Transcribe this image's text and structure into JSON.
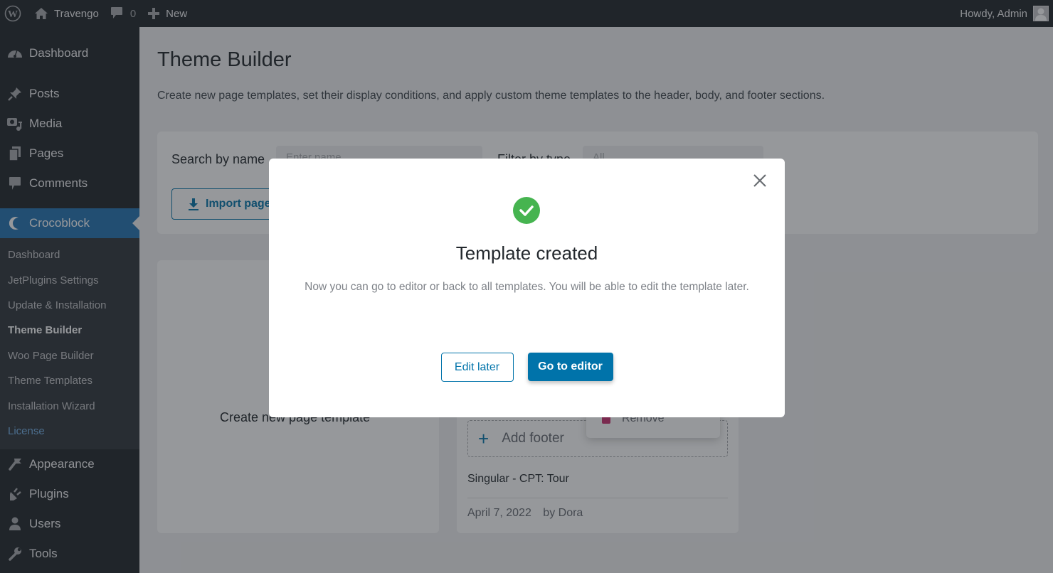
{
  "adminbar": {
    "site_name": "Travengo",
    "comments_count": "0",
    "new_label": "New",
    "greeting": "Howdy, Admin"
  },
  "sidebar": {
    "items": [
      {
        "label": "Dashboard",
        "icon": "dashboard-icon"
      },
      {
        "label": "Posts",
        "icon": "pin-icon"
      },
      {
        "label": "Media",
        "icon": "media-icon"
      },
      {
        "label": "Pages",
        "icon": "pages-icon"
      },
      {
        "label": "Comments",
        "icon": "comment-icon"
      },
      {
        "label": "Crocoblock",
        "icon": "crocoblock-icon",
        "active": true
      }
    ],
    "submenu": [
      {
        "label": "Dashboard"
      },
      {
        "label": "JetPlugins Settings"
      },
      {
        "label": "Update & Installation"
      },
      {
        "label": "Theme Builder",
        "current": true
      },
      {
        "label": "Woo Page Builder"
      },
      {
        "label": "Theme Templates"
      },
      {
        "label": "Installation Wizard"
      },
      {
        "label": "License"
      }
    ],
    "items_after": [
      {
        "label": "Appearance",
        "icon": "brush-icon"
      },
      {
        "label": "Plugins",
        "icon": "plugin-icon"
      },
      {
        "label": "Users",
        "icon": "user-icon"
      },
      {
        "label": "Tools",
        "icon": "wrench-icon"
      }
    ]
  },
  "main": {
    "title": "Theme Builder",
    "description": "Create new page templates, set their display conditions, and apply custom theme templates to the header, body, and footer sections.",
    "filters": {
      "search_label": "Search by name",
      "search_placeholder": "Enter name",
      "type_label": "Filter by type",
      "type_value": "All",
      "import_label": "Import page template"
    },
    "create_card": {
      "label": "Create new page template"
    },
    "template_card": {
      "add_footer_label": "Add footer",
      "name": "Singular - CPT: Tour",
      "date": "April 7, 2022",
      "author": "by Dora",
      "menu_remove_label": "Remove"
    }
  },
  "modal": {
    "title": "Template created",
    "text": "Now you can go to editor or back to all templates. You will be able to edit the template later.",
    "edit_later_label": "Edit later",
    "go_to_editor_label": "Go to editor"
  },
  "colors": {
    "accent": "#0073aa",
    "success": "#46b450",
    "wp_active": "#2271b1",
    "remove": "#c92c6d"
  }
}
